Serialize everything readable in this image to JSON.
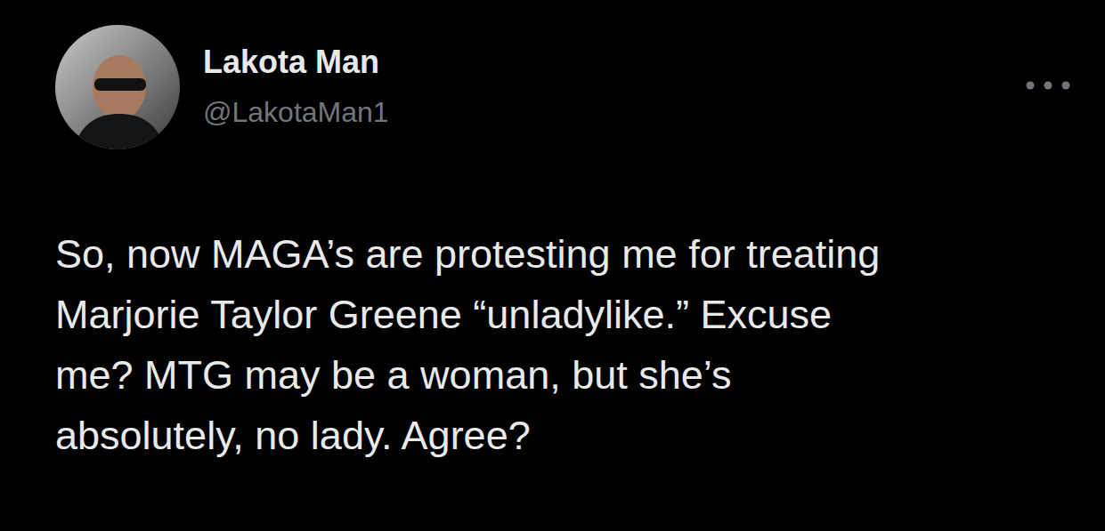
{
  "author": {
    "name": "Lakota Man",
    "handle": "@LakotaMan1"
  },
  "tweet": {
    "lines": [
      "So, now MAGA’s are protesting me for treating",
      "Marjorie Taylor Greene “unladylike.” Excuse",
      "me? MTG may be a woman, but she’s",
      "absolutely, no lady. Agree?"
    ]
  }
}
